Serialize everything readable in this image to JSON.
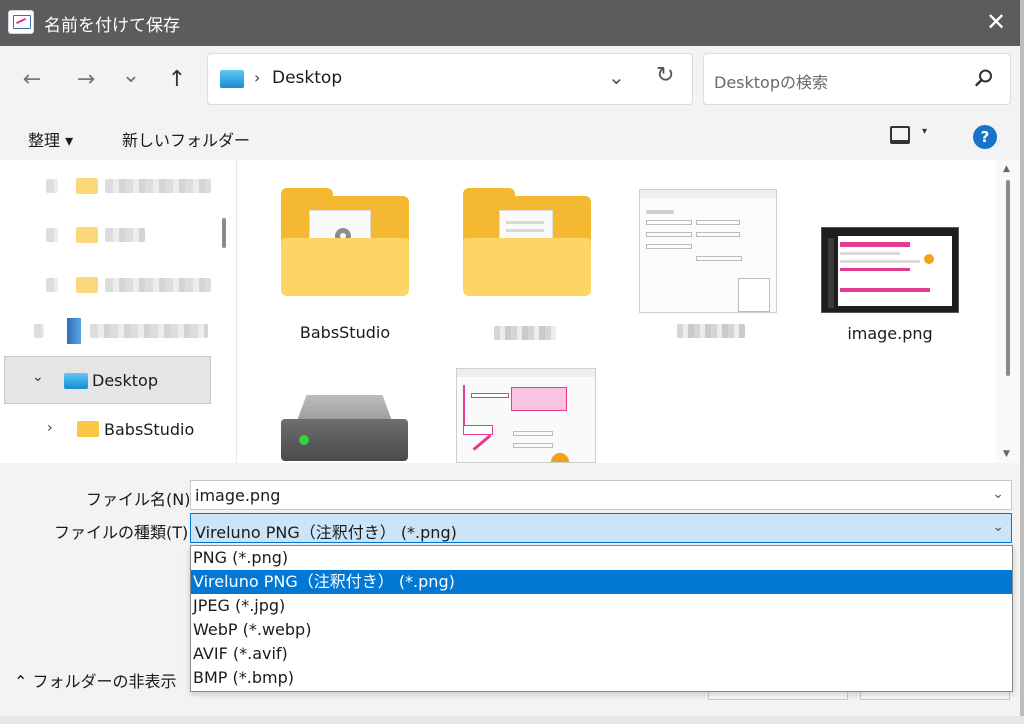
{
  "window": {
    "title": "名前を付けて保存",
    "close_glyph": "✕"
  },
  "nav": {
    "back_glyph": "←",
    "forward_glyph": "→",
    "recent_glyph": "⌄",
    "up_glyph": "↑",
    "address": "Desktop",
    "address_sep": "›",
    "address_dd_glyph": "⌄",
    "refresh_glyph": "↻",
    "search_placeholder": "Desktopの検索"
  },
  "commandbar": {
    "organize": "整理 ▾",
    "new_folder": "新しいフォルダー",
    "view_dd": "▾",
    "help": "?"
  },
  "sidebar": {
    "desktop_label": "Desktop",
    "desktop_chevron": "⌄",
    "babsstudio_label": "BabsStudio",
    "babsstudio_chevron": "›"
  },
  "content": {
    "items": [
      {
        "label": "BabsStudio",
        "kind": "folder"
      },
      {
        "label": "",
        "kind": "folder-blurred"
      },
      {
        "label": "",
        "kind": "image-blurred"
      },
      {
        "label": "image.png",
        "kind": "image"
      },
      {
        "label": "",
        "kind": "drive"
      },
      {
        "label": "",
        "kind": "image-partial"
      }
    ],
    "scroll_up_glyph": "▲",
    "scroll_down_glyph": "▼"
  },
  "form": {
    "filename_label": "ファイル名(N):",
    "filename_value": "image.png",
    "filetype_label": "ファイルの種類(T):",
    "filetype_value": "Vireluno PNG（注釈付き） (*.png)",
    "dd_glyph": "⌄"
  },
  "filetype_options": [
    "PNG (*.png)",
    "Vireluno PNG（注釈付き） (*.png)",
    "JPEG (*.jpg)",
    "WebP (*.webp)",
    "AVIF (*.avif)",
    "BMP (*.bmp)"
  ],
  "selected_option_index": 1,
  "footer": {
    "hide_folders": "⌃ フォルダーの非表示"
  },
  "colors": {
    "accent": "#0078d4",
    "titlebar": "#5c5c5c",
    "folder": "#f4b931"
  }
}
